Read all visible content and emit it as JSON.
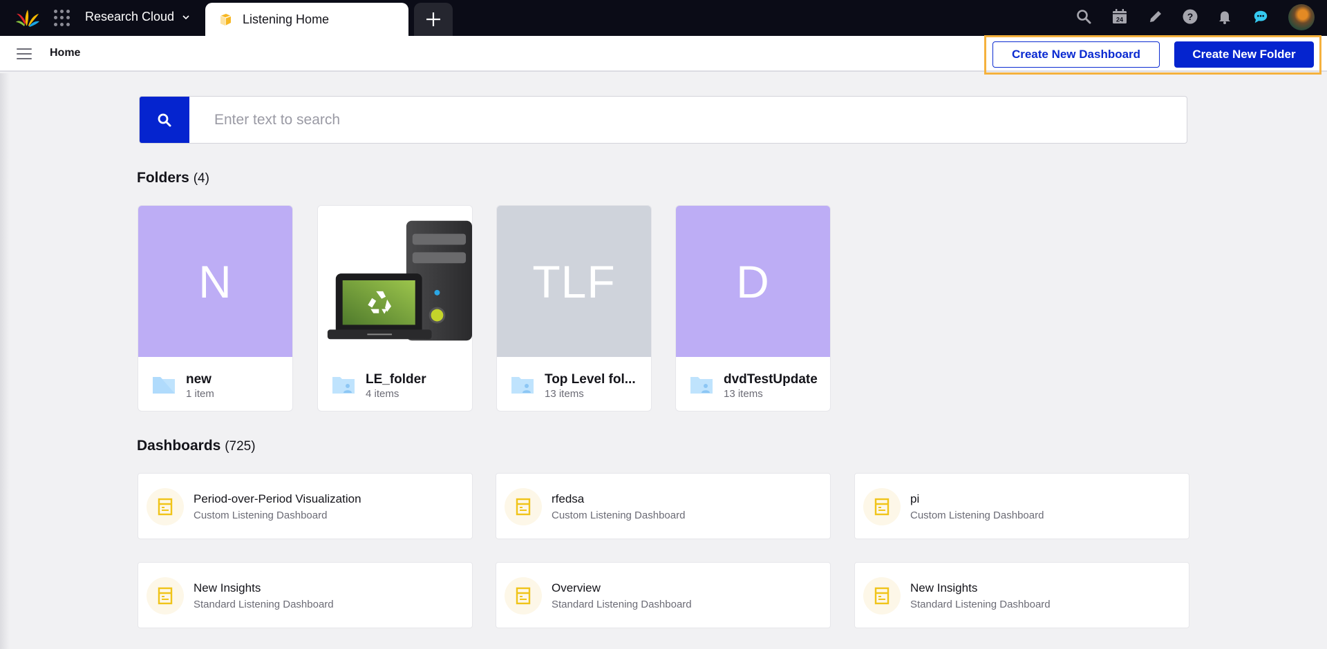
{
  "topbar": {
    "workspace": "Research Cloud",
    "active_tab": "Listening Home",
    "icons": [
      "search-icon",
      "calendar-icon",
      "pencil-icon",
      "help-icon",
      "bell-icon",
      "chat-icon",
      "avatar"
    ],
    "calendar_day": "24"
  },
  "subheader": {
    "breadcrumb": "Home",
    "create_dashboard_label": "Create New Dashboard",
    "create_folder_label": "Create New Folder"
  },
  "search": {
    "placeholder": "Enter text to search",
    "value": ""
  },
  "folders": {
    "title": "Folders",
    "count": "(4)",
    "items": [
      {
        "thumb_text": "N",
        "thumb_color": "#bdadf5",
        "name": "new",
        "count": "1 item",
        "shared": false
      },
      {
        "thumb_text": "",
        "thumb_color": "#ffffff",
        "name": "LE_folder",
        "count": "4 items",
        "shared": true
      },
      {
        "thumb_text": "TLF",
        "thumb_color": "#cfd3db",
        "name": "Top Level fol...",
        "count": "13 items",
        "shared": true
      },
      {
        "thumb_text": "D",
        "thumb_color": "#bdadf5",
        "name": "dvdTestUpdate",
        "count": "13 items",
        "shared": true
      }
    ]
  },
  "dashboards": {
    "title": "Dashboards",
    "count": "(725)",
    "items": [
      {
        "title": "Period-over-Period Visualization",
        "type": "Custom Listening Dashboard"
      },
      {
        "title": "rfedsa",
        "type": "Custom Listening Dashboard"
      },
      {
        "title": "pi",
        "type": "Custom Listening Dashboard"
      },
      {
        "title": "New Insights",
        "type": "Standard Listening Dashboard"
      },
      {
        "title": "Overview",
        "type": "Standard Listening Dashboard"
      },
      {
        "title": "New Insights",
        "type": "Standard Listening Dashboard"
      }
    ]
  },
  "colors": {
    "primary": "#0524cf",
    "highlight": "#f5b13d",
    "topbar_bg": "#0b0c17",
    "dashboard_icon": "#f0c419",
    "chat_icon": "#35c9f0"
  }
}
